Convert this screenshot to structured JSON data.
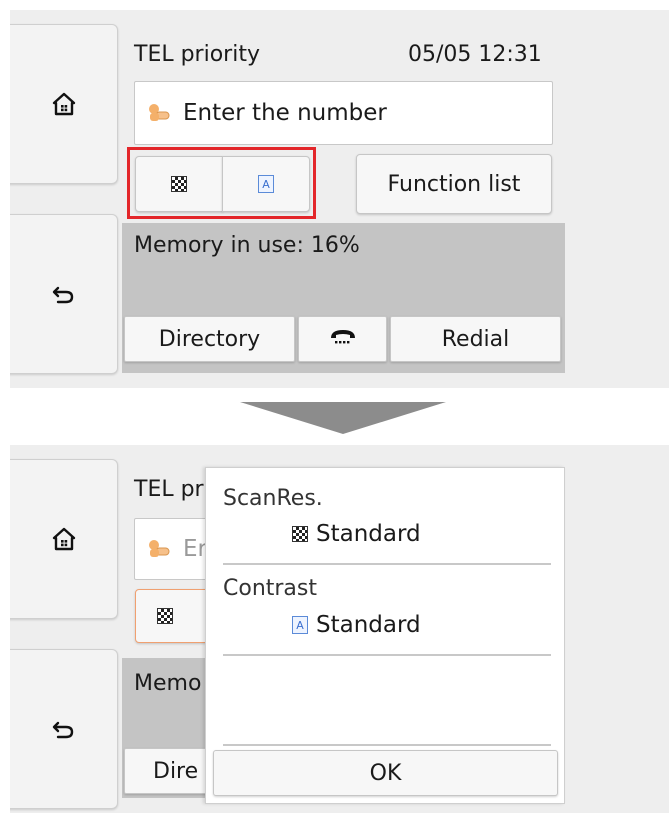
{
  "before": {
    "header": {
      "mode_label": "TEL priority",
      "datetime": "05/05 12:31"
    },
    "number_input": {
      "placeholder": "Enter the number"
    },
    "quick_settings": {
      "scan_res_icon": "checker-icon",
      "contrast_icon": "contrast-a-icon"
    },
    "function_list_label": "Function list",
    "memory_status": "Memory in use: 16%",
    "bottom_bar": {
      "directory_label": "Directory",
      "hook_icon": "phone-hook-icon",
      "redial_label": "Redial"
    },
    "side": {
      "home_icon": "home-icon",
      "back_icon": "back-arrow-icon"
    },
    "highlight_color": "#e3262a"
  },
  "transition_arrow": "down-arrow",
  "after": {
    "header": {
      "mode_label_partial": "TEL pr"
    },
    "number_input": {
      "placeholder_partial": "Er"
    },
    "memory_partial": "Memo",
    "directory_partial": "Dire",
    "popup": {
      "scan_res_label": "ScanRes.",
      "scan_res_value": "Standard",
      "contrast_label": "Contrast",
      "contrast_value": "Standard",
      "ok_label": "OK"
    }
  }
}
